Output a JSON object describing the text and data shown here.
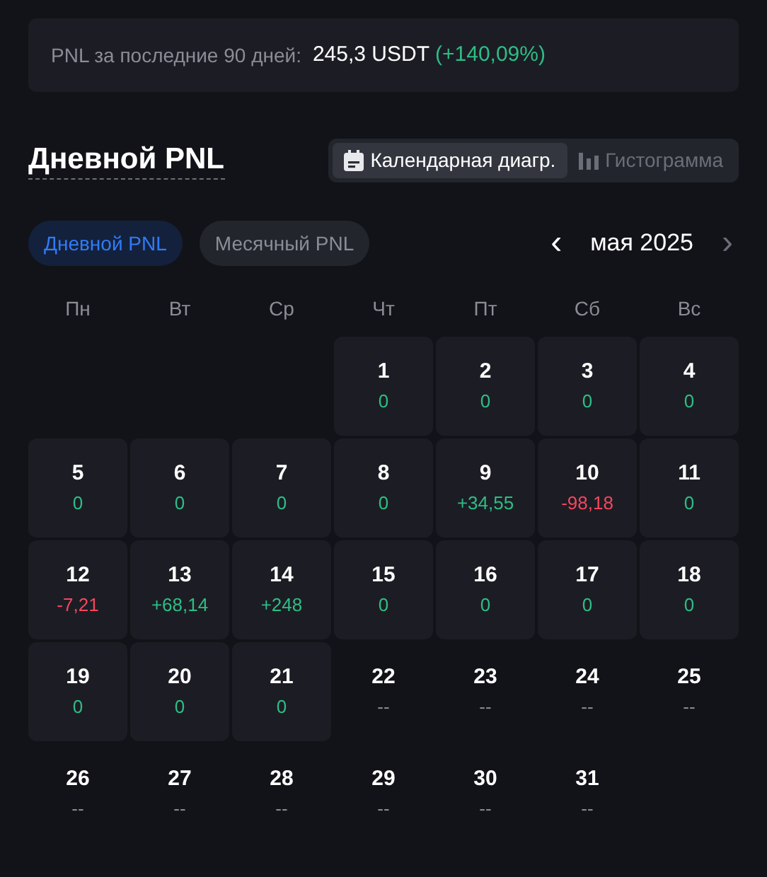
{
  "summary": {
    "label": "PNL за последние 90 дней:",
    "amount": "245,3 USDT",
    "change": "(+140,09%)"
  },
  "title": "Дневной PNL",
  "view_tabs": [
    {
      "label": "Календарная диагр.",
      "selected": true
    },
    {
      "label": "Гистограмма",
      "selected": false
    }
  ],
  "period_tabs": [
    {
      "label": "Дневной PNL",
      "selected": true
    },
    {
      "label": "Месячный PNL",
      "selected": false
    }
  ],
  "month": {
    "prev": "‹",
    "label": "мая 2025",
    "next": "›"
  },
  "weekdays": [
    "Пн",
    "Вт",
    "Ср",
    "Чт",
    "Пт",
    "Сб",
    "Вс"
  ],
  "weeks": [
    [
      {
        "kind": "blank"
      },
      {
        "kind": "blank"
      },
      {
        "kind": "blank"
      },
      {
        "day": "1",
        "pnl": "0",
        "color": "#2ebd85",
        "kind": "past"
      },
      {
        "day": "2",
        "pnl": "0",
        "color": "#2ebd85",
        "kind": "past"
      },
      {
        "day": "3",
        "pnl": "0",
        "color": "#2ebd85",
        "kind": "past"
      },
      {
        "day": "4",
        "pnl": "0",
        "color": "#2ebd85",
        "kind": "past"
      }
    ],
    [
      {
        "day": "5",
        "pnl": "0",
        "color": "#2ebd85",
        "kind": "past"
      },
      {
        "day": "6",
        "pnl": "0",
        "color": "#2ebd85",
        "kind": "past"
      },
      {
        "day": "7",
        "pnl": "0",
        "color": "#2ebd85",
        "kind": "past"
      },
      {
        "day": "8",
        "pnl": "0",
        "color": "#2ebd85",
        "kind": "past"
      },
      {
        "day": "9",
        "pnl": "+34,55",
        "color": "#2ebd85",
        "kind": "past"
      },
      {
        "day": "10",
        "pnl": "-98,18",
        "color": "#f6465d",
        "kind": "past"
      },
      {
        "day": "11",
        "pnl": "0",
        "color": "#2ebd85",
        "kind": "past"
      }
    ],
    [
      {
        "day": "12",
        "pnl": "-7,21",
        "color": "#f6465d",
        "kind": "past"
      },
      {
        "day": "13",
        "pnl": "+68,14",
        "color": "#2ebd85",
        "kind": "past"
      },
      {
        "day": "14",
        "pnl": "+248",
        "color": "#2ebd85",
        "kind": "past"
      },
      {
        "day": "15",
        "pnl": "0",
        "color": "#2ebd85",
        "kind": "past"
      },
      {
        "day": "16",
        "pnl": "0",
        "color": "#2ebd85",
        "kind": "past"
      },
      {
        "day": "17",
        "pnl": "0",
        "color": "#2ebd85",
        "kind": "past"
      },
      {
        "day": "18",
        "pnl": "0",
        "color": "#2ebd85",
        "kind": "past"
      }
    ],
    [
      {
        "day": "19",
        "pnl": "0",
        "color": "#2ebd85",
        "kind": "past"
      },
      {
        "day": "20",
        "pnl": "0",
        "color": "#2ebd85",
        "kind": "past"
      },
      {
        "day": "21",
        "pnl": "0",
        "color": "#2ebd85",
        "kind": "past"
      },
      {
        "day": "22",
        "pnl": "--",
        "color": "#8a8d96",
        "kind": "future"
      },
      {
        "day": "23",
        "pnl": "--",
        "color": "#8a8d96",
        "kind": "future"
      },
      {
        "day": "24",
        "pnl": "--",
        "color": "#8a8d96",
        "kind": "future"
      },
      {
        "day": "25",
        "pnl": "--",
        "color": "#8a8d96",
        "kind": "future"
      }
    ],
    [
      {
        "day": "26",
        "pnl": "--",
        "color": "#8a8d96",
        "kind": "future"
      },
      {
        "day": "27",
        "pnl": "--",
        "color": "#8a8d96",
        "kind": "future"
      },
      {
        "day": "28",
        "pnl": "--",
        "color": "#8a8d96",
        "kind": "future"
      },
      {
        "day": "29",
        "pnl": "--",
        "color": "#8a8d96",
        "kind": "future"
      },
      {
        "day": "30",
        "pnl": "--",
        "color": "#8a8d96",
        "kind": "future"
      },
      {
        "day": "31",
        "pnl": "--",
        "color": "#8a8d96",
        "kind": "future"
      }
    ]
  ]
}
